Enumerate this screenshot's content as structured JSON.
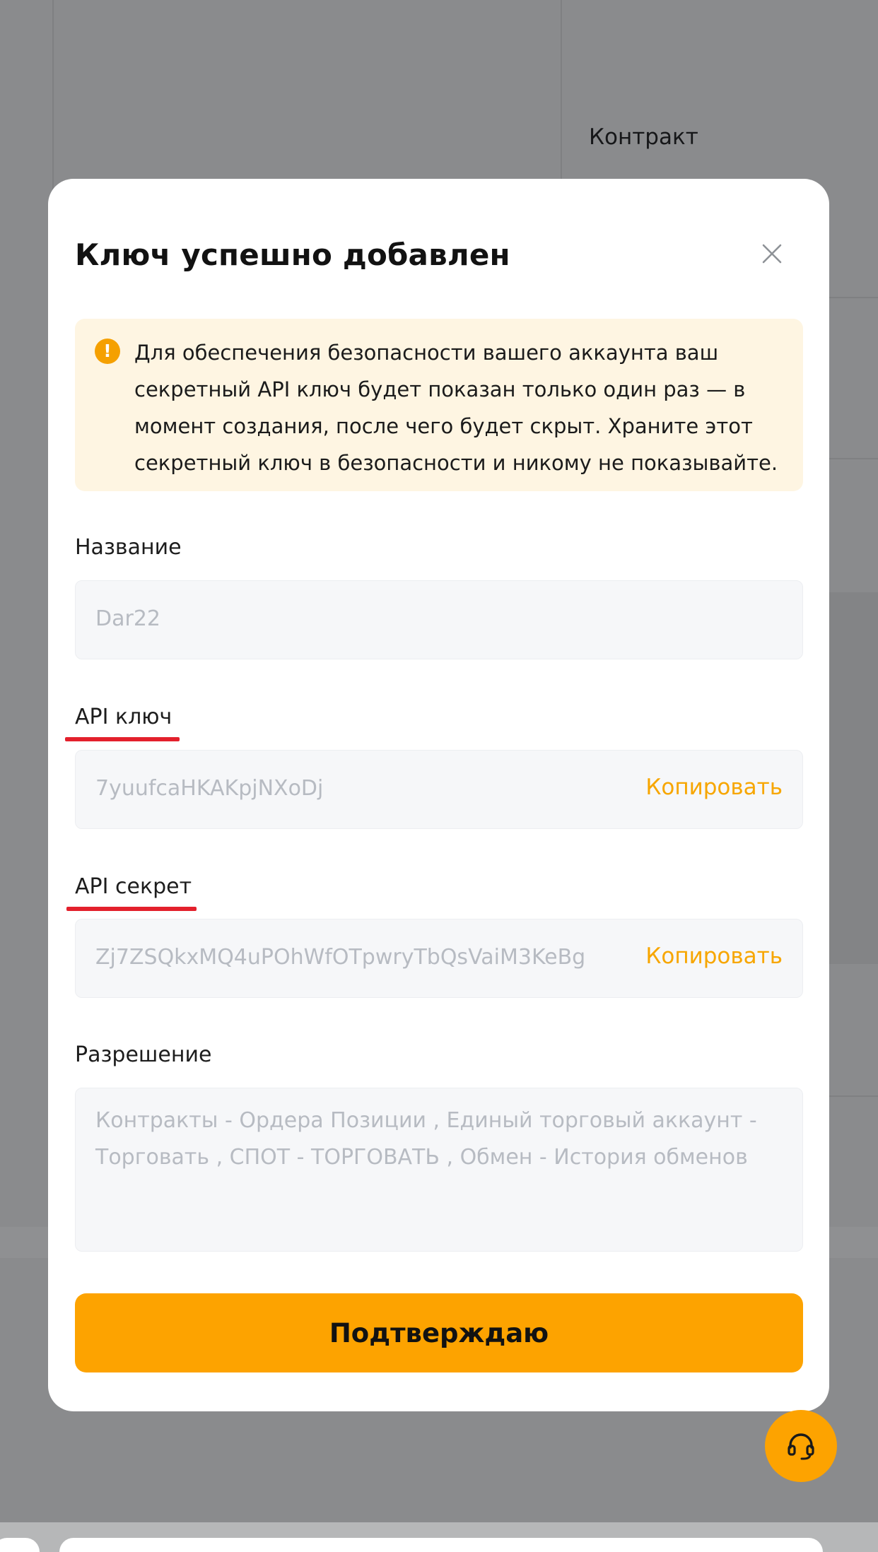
{
  "background": {
    "contract_label": "Контракт"
  },
  "modal": {
    "title": "Ключ успешно добавлен",
    "close_icon": "close-icon",
    "notice": {
      "icon": "warning-icon",
      "text": "Для обеспечения безопасности вашего аккаунта ваш секретный API ключ будет показан только один раз — в момент создания, после чего будет скрыт. Храните этот секретный ключ в безопасности и никому не показывайте."
    },
    "name_field": {
      "label": "Название",
      "value": "Dar22"
    },
    "api_key_field": {
      "label": "API ключ",
      "value": "7yuufcaHKAKpjNXoDj",
      "copy_label": "Копировать"
    },
    "api_secret_field": {
      "label": "API секрет",
      "value": "Zj7ZSQkxMQ4uPOhWfOTpwryTbQsVaiM3KeBg",
      "copy_label": "Копировать"
    },
    "permission_field": {
      "label": "Разрешение",
      "value": "Контракты - Ордера Позиции  , Единый торговый аккаунт - Торговать  , СПОТ - ТОРГОВАТЬ  , Обмен - История обменов"
    },
    "confirm_label": "Подтверждаю"
  },
  "support": {
    "icon": "headset-icon"
  },
  "colors": {
    "accent": "#fda300",
    "copy_text": "#f7a600",
    "annotation_underline": "#e3202c",
    "notice_bg": "#fef5e2"
  }
}
